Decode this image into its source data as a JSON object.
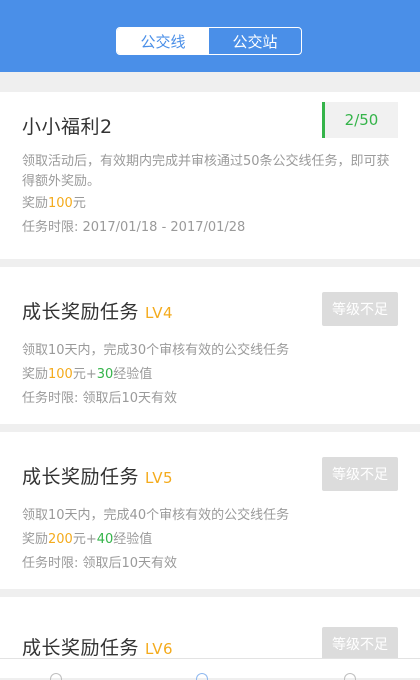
{
  "tabs": [
    {
      "label": "公交线",
      "active": true
    },
    {
      "label": "公交站",
      "active": false
    }
  ],
  "colors": {
    "header": "#4a8fe8",
    "accent_green": "#35b44a",
    "accent_orange": "#f4ab1d"
  },
  "tasks": [
    {
      "title": "小小福利2",
      "progress": "2/50",
      "description": "领取活动后，有效期内完成并审核通过50条公交线任务，即可获得额外奖励。",
      "reward_prefix": "奖励",
      "reward_amount": "100",
      "reward_unit": "元",
      "time_label": "任务时限: ",
      "time_value": "2017/01/18 - 2017/01/28"
    },
    {
      "title": "成长奖励任务",
      "level": "LV4",
      "button": "等级不足",
      "description": "领取10天内，完成30个审核有效的公交线任务",
      "reward_prefix": "奖励",
      "reward_amount": "100",
      "reward_unit": "元+",
      "exp_amount": "30",
      "exp_unit": "经验值",
      "time_label": "任务时限: ",
      "time_value": "领取后10天有效"
    },
    {
      "title": "成长奖励任务",
      "level": "LV5",
      "button": "等级不足",
      "description": "领取10天内，完成40个审核有效的公交线任务",
      "reward_prefix": "奖励",
      "reward_amount": "200",
      "reward_unit": "元+",
      "exp_amount": "40",
      "exp_unit": "经验值",
      "time_label": "任务时限: ",
      "time_value": "领取后10天有效"
    },
    {
      "title": "成长奖励任务",
      "level": "LV6",
      "button": "等级不足"
    }
  ]
}
